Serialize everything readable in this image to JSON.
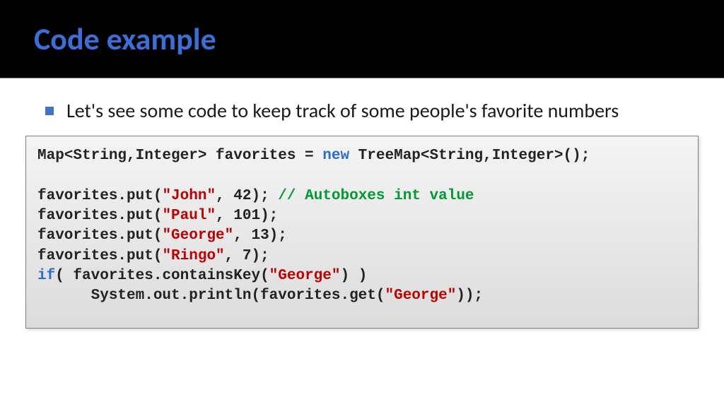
{
  "header": {
    "title": "Code example"
  },
  "bullet": "Let's see some code to keep track of some people's favorite numbers",
  "code": {
    "tokens": [
      [
        {
          "t": "Map<String,Integer> favorites = "
        },
        {
          "t": "new",
          "c": "kw"
        },
        {
          "t": " TreeMap<String,Integer>();"
        }
      ],
      [
        {
          "t": ""
        }
      ],
      [
        {
          "t": "favorites.put("
        },
        {
          "t": "\"John\"",
          "c": "str"
        },
        {
          "t": ", 42); "
        },
        {
          "t": "// Autoboxes int value",
          "c": "cmt"
        }
      ],
      [
        {
          "t": "favorites.put("
        },
        {
          "t": "\"Paul\"",
          "c": "str"
        },
        {
          "t": ", 101);"
        }
      ],
      [
        {
          "t": "favorites.put("
        },
        {
          "t": "\"George\"",
          "c": "str"
        },
        {
          "t": ", 13);"
        }
      ],
      [
        {
          "t": "favorites.put("
        },
        {
          "t": "\"Ringo\"",
          "c": "str"
        },
        {
          "t": ", 7);"
        }
      ],
      [
        {
          "t": "if",
          "c": "kw"
        },
        {
          "t": "( favorites.containsKey("
        },
        {
          "t": "\"George\"",
          "c": "str"
        },
        {
          "t": ") )"
        }
      ],
      [
        {
          "t": "      System.out.println(favorites.get("
        },
        {
          "t": "\"George\"",
          "c": "str"
        },
        {
          "t": "));"
        }
      ]
    ]
  }
}
